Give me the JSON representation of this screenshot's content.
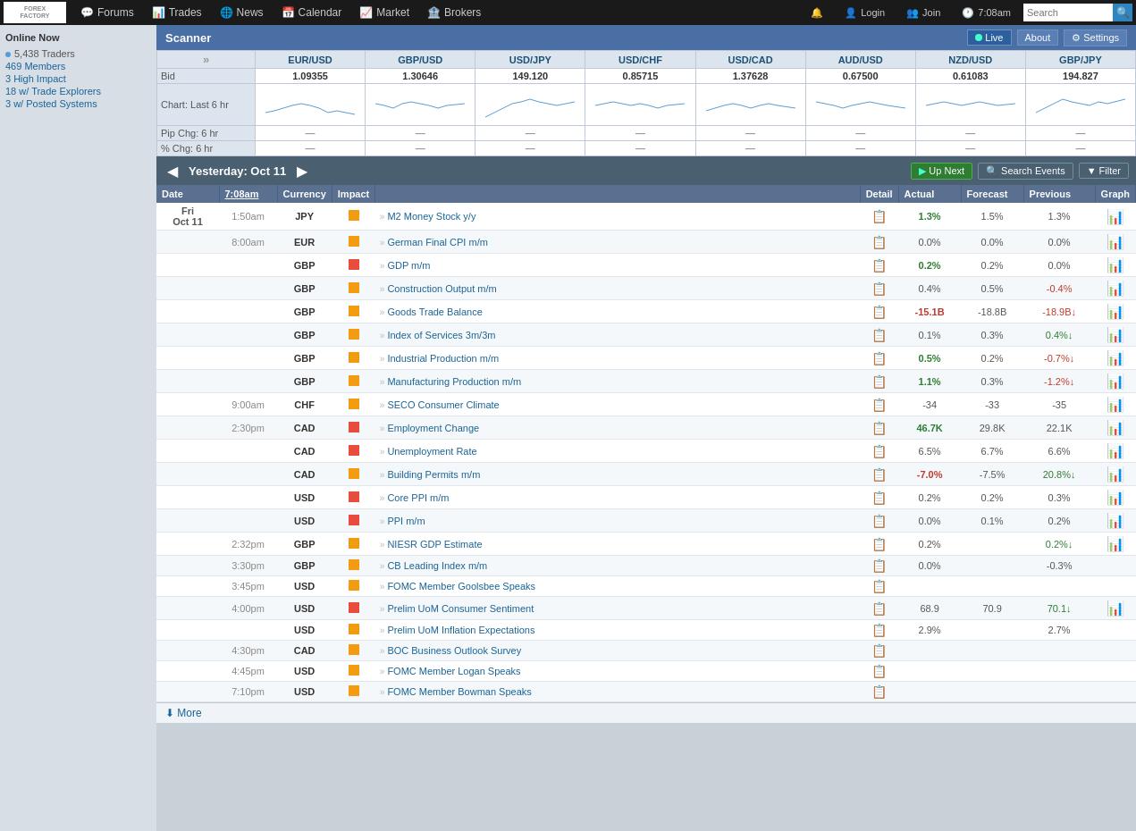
{
  "logo": {
    "line1": "FOREX",
    "line2": "FACTORY"
  },
  "nav": {
    "items": [
      {
        "id": "forums",
        "label": "Forums",
        "icon": "💬"
      },
      {
        "id": "trades",
        "label": "Trades",
        "icon": "📊"
      },
      {
        "id": "news",
        "label": "News",
        "icon": "🌐"
      },
      {
        "id": "calendar",
        "label": "Calendar",
        "icon": "📅"
      },
      {
        "id": "market",
        "label": "Market",
        "icon": "📈"
      },
      {
        "id": "brokers",
        "label": "Brokers",
        "icon": "🏦"
      }
    ],
    "right": [
      {
        "id": "notifications",
        "icon": "🔔"
      },
      {
        "id": "login",
        "label": "Login",
        "icon": "👤"
      },
      {
        "id": "join",
        "label": "Join",
        "icon": "👥"
      },
      {
        "id": "time",
        "label": "7:08am",
        "icon": "🕐"
      }
    ],
    "search_placeholder": "Search"
  },
  "sidebar": {
    "online_title": "Online Now",
    "traders": "5,438 Traders",
    "members": "469 Members",
    "high_impact": "3 High Impact",
    "trade_explorers": "18 w/ Trade Explorers",
    "posted_systems": "3 w/ Posted Systems"
  },
  "scanner": {
    "title": "Scanner",
    "live_label": "Live",
    "about_label": "About",
    "settings_label": "Settings",
    "row_bid": "Bid",
    "row_chart": "Chart: Last 6 hr",
    "row_pip": "Pip Chg: 6 hr",
    "row_pct": "% Chg: 6 hr",
    "pairs": [
      {
        "name": "EUR/USD",
        "price": "1.09355",
        "pip": "—",
        "pct": "—"
      },
      {
        "name": "GBP/USD",
        "price": "1.30646",
        "pip": "—",
        "pct": "—"
      },
      {
        "name": "USD/JPY",
        "price": "149.120",
        "pip": "—",
        "pct": "—"
      },
      {
        "name": "USD/CHF",
        "price": "0.85715",
        "pip": "—",
        "pct": "—"
      },
      {
        "name": "USD/CAD",
        "price": "1.37628",
        "pip": "—",
        "pct": "—"
      },
      {
        "name": "AUD/USD",
        "price": "0.67500",
        "pip": "—",
        "pct": "—"
      },
      {
        "name": "NZD/USD",
        "price": "0.61083",
        "pip": "—",
        "pct": "—"
      },
      {
        "name": "GBP/JPY",
        "price": "194.827",
        "pip": "—",
        "pct": "—"
      }
    ]
  },
  "calendar": {
    "nav_prev": "◀",
    "nav_next": "▶",
    "date_label": "Yesterday: Oct 11",
    "up_next_label": "Up Next",
    "search_events_label": "Search Events",
    "filter_label": "Filter",
    "columns": [
      "Date",
      "7:08am",
      "Currency",
      "Impact",
      "Detail",
      "Actual",
      "Forecast",
      "Previous",
      "Graph"
    ],
    "events": [
      {
        "date": "Fri\nOct 11",
        "time": "1:50am",
        "currency": "JPY",
        "impact": "medium",
        "event": "M2 Money Stock y/y",
        "actual": "1.3%",
        "actual_class": "green",
        "forecast": "1.5%",
        "previous": "1.3%",
        "previous_class": "normal",
        "has_graph": true
      },
      {
        "date": "",
        "time": "8:00am",
        "currency": "EUR",
        "impact": "medium",
        "event": "German Final CPI m/m",
        "actual": "0.0%",
        "actual_class": "normal",
        "forecast": "0.0%",
        "previous": "0.0%",
        "previous_class": "normal",
        "has_graph": true
      },
      {
        "date": "",
        "time": "",
        "currency": "GBP",
        "impact": "high",
        "event": "GDP m/m",
        "actual": "0.2%",
        "actual_class": "green",
        "forecast": "0.2%",
        "previous": "0.0%",
        "previous_class": "normal",
        "has_graph": true
      },
      {
        "date": "",
        "time": "",
        "currency": "GBP",
        "impact": "medium",
        "event": "Construction Output m/m",
        "actual": "0.4%",
        "actual_class": "normal",
        "forecast": "0.5%",
        "previous": "-0.4%",
        "previous_class": "red",
        "has_graph": true
      },
      {
        "date": "",
        "time": "",
        "currency": "GBP",
        "impact": "medium",
        "event": "Goods Trade Balance",
        "actual": "-15.1B",
        "actual_class": "red",
        "forecast": "-18.8B",
        "previous": "-18.9B↓",
        "previous_class": "red",
        "has_graph": true
      },
      {
        "date": "",
        "time": "",
        "currency": "GBP",
        "impact": "medium",
        "event": "Index of Services 3m/3m",
        "actual": "0.1%",
        "actual_class": "normal",
        "forecast": "0.3%",
        "previous": "0.4%↓",
        "previous_class": "green",
        "has_graph": true
      },
      {
        "date": "",
        "time": "",
        "currency": "GBP",
        "impact": "medium",
        "event": "Industrial Production m/m",
        "actual": "0.5%",
        "actual_class": "green",
        "forecast": "0.2%",
        "previous": "-0.7%↓",
        "previous_class": "red",
        "has_graph": true
      },
      {
        "date": "",
        "time": "",
        "currency": "GBP",
        "impact": "medium",
        "event": "Manufacturing Production m/m",
        "actual": "1.1%",
        "actual_class": "green",
        "forecast": "0.3%",
        "previous": "-1.2%↓",
        "previous_class": "red",
        "has_graph": true
      },
      {
        "date": "",
        "time": "9:00am",
        "currency": "CHF",
        "impact": "medium",
        "event": "SECO Consumer Climate",
        "actual": "-34",
        "actual_class": "normal",
        "forecast": "-33",
        "previous": "-35",
        "previous_class": "normal",
        "has_graph": true
      },
      {
        "date": "",
        "time": "2:30pm",
        "currency": "CAD",
        "impact": "high",
        "event": "Employment Change",
        "actual": "46.7K",
        "actual_class": "green",
        "forecast": "29.8K",
        "previous": "22.1K",
        "previous_class": "normal",
        "has_graph": true
      },
      {
        "date": "",
        "time": "",
        "currency": "CAD",
        "impact": "high",
        "event": "Unemployment Rate",
        "actual": "6.5%",
        "actual_class": "normal",
        "forecast": "6.7%",
        "previous": "6.6%",
        "previous_class": "normal",
        "has_graph": true
      },
      {
        "date": "",
        "time": "",
        "currency": "CAD",
        "impact": "medium",
        "event": "Building Permits m/m",
        "actual": "-7.0%",
        "actual_class": "red",
        "forecast": "-7.5%",
        "previous": "20.8%↓",
        "previous_class": "green",
        "has_graph": true
      },
      {
        "date": "",
        "time": "",
        "currency": "USD",
        "impact": "high",
        "event": "Core PPI m/m",
        "actual": "0.2%",
        "actual_class": "normal",
        "forecast": "0.2%",
        "previous": "0.3%",
        "previous_class": "normal",
        "has_graph": true
      },
      {
        "date": "",
        "time": "",
        "currency": "USD",
        "impact": "high",
        "event": "PPI m/m",
        "actual": "0.0%",
        "actual_class": "normal",
        "forecast": "0.1%",
        "previous": "0.2%",
        "previous_class": "normal",
        "has_graph": true
      },
      {
        "date": "",
        "time": "2:32pm",
        "currency": "GBP",
        "impact": "medium",
        "event": "NIESR GDP Estimate",
        "actual": "0.2%",
        "actual_class": "normal",
        "forecast": "",
        "previous": "0.2%↓",
        "previous_class": "green",
        "has_graph": true
      },
      {
        "date": "",
        "time": "3:30pm",
        "currency": "GBP",
        "impact": "medium",
        "event": "CB Leading Index m/m",
        "actual": "0.0%",
        "actual_class": "normal",
        "forecast": "",
        "previous": "-0.3%",
        "previous_class": "normal",
        "has_graph": false
      },
      {
        "date": "",
        "time": "3:45pm",
        "currency": "USD",
        "impact": "medium",
        "event": "FOMC Member Goolsbee Speaks",
        "actual": "",
        "actual_class": "normal",
        "forecast": "",
        "previous": "",
        "previous_class": "normal",
        "has_graph": false
      },
      {
        "date": "",
        "time": "4:00pm",
        "currency": "USD",
        "impact": "high",
        "event": "Prelim UoM Consumer Sentiment",
        "actual": "68.9",
        "actual_class": "normal",
        "forecast": "70.9",
        "previous": "70.1↓",
        "previous_class": "green",
        "has_graph": true
      },
      {
        "date": "",
        "time": "",
        "currency": "USD",
        "impact": "medium",
        "event": "Prelim UoM Inflation Expectations",
        "actual": "2.9%",
        "actual_class": "normal",
        "forecast": "",
        "previous": "2.7%",
        "previous_class": "normal",
        "has_graph": false
      },
      {
        "date": "",
        "time": "4:30pm",
        "currency": "CAD",
        "impact": "medium",
        "event": "BOC Business Outlook Survey",
        "actual": "",
        "actual_class": "normal",
        "forecast": "",
        "previous": "",
        "previous_class": "normal",
        "has_graph": false
      },
      {
        "date": "",
        "time": "4:45pm",
        "currency": "USD",
        "impact": "medium",
        "event": "FOMC Member Logan Speaks",
        "actual": "",
        "actual_class": "normal",
        "forecast": "",
        "previous": "",
        "previous_class": "normal",
        "has_graph": false
      },
      {
        "date": "",
        "time": "7:10pm",
        "currency": "USD",
        "impact": "medium",
        "event": "FOMC Member Bowman Speaks",
        "actual": "",
        "actual_class": "normal",
        "forecast": "",
        "previous": "",
        "previous_class": "normal",
        "has_graph": false
      }
    ],
    "more_label": "⬇ More"
  }
}
